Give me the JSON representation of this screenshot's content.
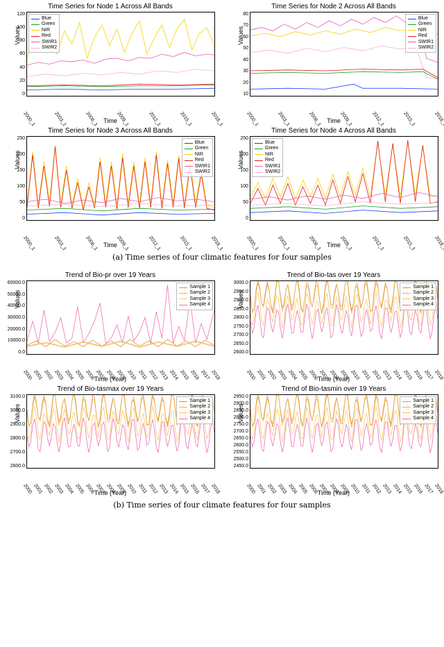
{
  "caption_a": "(a) Time series of four climatic features for four samples",
  "caption_b": "(b) Time series of four climate features for four samples",
  "xlabel_a": "Time",
  "xlabel_b": "Time (Year)",
  "ylabel": "Values",
  "legend_bands": [
    "Blue",
    "Green",
    "NIR",
    "Red",
    "SWIR1",
    "SWIR2"
  ],
  "legend_samples": [
    "Sample 1",
    "Sample 2",
    "Sample 3",
    "Sample 4"
  ],
  "band_colors": {
    "Blue": "#1f3cff",
    "Green": "#1b9e1b",
    "NIR": "#f6d400",
    "Red": "#e11919",
    "SWIR1": "#e859b4",
    "SWIR2": "#f2b2d8"
  },
  "sample_colors": {
    "Sample 1": "#e98c3a",
    "Sample 2": "#e6b84f",
    "Sample 3": "#f7c66f",
    "Sample 4": "#ef6fb2"
  },
  "xticks_a": [
    "2000_1",
    "2003_1",
    "2006_1",
    "2009_1",
    "2012_1",
    "2015_1",
    "2018_1"
  ],
  "xticks_b": [
    "2000",
    "2001",
    "2002",
    "2003",
    "2004",
    "2005",
    "2006",
    "2007",
    "2008",
    "2009",
    "2010",
    "2011",
    "2012",
    "2013",
    "2014",
    "2015",
    "2016",
    "2017",
    "2018"
  ],
  "chart_data": [
    {
      "title": "Time Series for Node 1 Across All Bands",
      "type": "line",
      "xlabel": "Time",
      "ylabel": "Values",
      "x": [
        "2000_1",
        "2003_1",
        "2006_1",
        "2009_1",
        "2012_1",
        "2015_1",
        "2018_1"
      ],
      "ylim": [
        0,
        120
      ],
      "yticks": [
        0,
        20,
        40,
        60,
        80,
        100,
        120
      ],
      "series": [
        {
          "name": "Blue",
          "approx_range": [
            7,
            12
          ],
          "mean": 9
        },
        {
          "name": "Green",
          "approx_range": [
            10,
            16
          ],
          "mean": 13
        },
        {
          "name": "NIR",
          "approx_range": [
            40,
            115
          ],
          "mean": 80,
          "note": "high-amplitude oscillation"
        },
        {
          "name": "Red",
          "approx_range": [
            12,
            18
          ],
          "mean": 14
        },
        {
          "name": "SWIR1",
          "approx_range": [
            35,
            58
          ],
          "mean": 48
        },
        {
          "name": "SWIR2",
          "approx_range": [
            20,
            35
          ],
          "mean": 27
        }
      ]
    },
    {
      "title": "Time Series for Node 2 Across All Bands",
      "type": "line",
      "xlabel": "Time",
      "ylabel": "Values",
      "x": [
        "2000_1",
        "2003_1",
        "2006_1",
        "2009_1",
        "2012_1",
        "2015_1",
        "2018_1"
      ],
      "ylim": [
        10,
        80
      ],
      "yticks": [
        10,
        20,
        30,
        40,
        50,
        60,
        70,
        80
      ],
      "series": [
        {
          "name": "Blue",
          "approx_range": [
            12,
            18
          ],
          "mean": 14
        },
        {
          "name": "Green",
          "approx_range": [
            20,
            26
          ],
          "mean": 22
        },
        {
          "name": "NIR",
          "approx_range": [
            58,
            72
          ],
          "mean": 62
        },
        {
          "name": "Red",
          "approx_range": [
            22,
            28
          ],
          "mean": 24
        },
        {
          "name": "SWIR1",
          "approx_range": [
            60,
            78
          ],
          "mean": 68,
          "note": "drops sharply to ~30 near 2019"
        },
        {
          "name": "SWIR2",
          "approx_range": [
            33,
            45
          ],
          "mean": 40,
          "note": "drops sharply to ~18 near 2019"
        }
      ]
    },
    {
      "title": "Time Series for Node 3 Across All Bands",
      "type": "line",
      "xlabel": "Time",
      "ylabel": "Values",
      "x": [
        "2000_1",
        "2003_1",
        "2006_1",
        "2009_1",
        "2012_1",
        "2015_1",
        "2018_1"
      ],
      "ylim": [
        0,
        250
      ],
      "yticks": [
        0,
        50,
        100,
        150,
        200,
        250
      ],
      "series": [
        {
          "name": "Blue",
          "approx_range": [
            10,
            40
          ],
          "mean": 20
        },
        {
          "name": "Green",
          "approx_range": [
            15,
            60
          ],
          "mean": 30
        },
        {
          "name": "NIR",
          "approx_range": [
            40,
            230
          ],
          "mean": 90,
          "note": "strong annual spikes to 200–230"
        },
        {
          "name": "Red",
          "approx_range": [
            20,
            225
          ],
          "mean": 60,
          "note": "strong annual spikes"
        },
        {
          "name": "SWIR1",
          "approx_range": [
            30,
            80
          ],
          "mean": 45
        },
        {
          "name": "SWIR2",
          "approx_range": [
            20,
            55
          ],
          "mean": 35
        }
      ]
    },
    {
      "title": "Time Series for Node 4 Across All Bands",
      "type": "line",
      "xlabel": "Time",
      "ylabel": "Values",
      "x": [
        "2000_1",
        "2003_1",
        "2006_1",
        "2009_1",
        "2012_1",
        "2015_1",
        "2018_1"
      ],
      "ylim": [
        0,
        250
      ],
      "yticks": [
        0,
        50,
        100,
        150,
        200,
        250
      ],
      "series": [
        {
          "name": "Blue",
          "approx_range": [
            15,
            45
          ],
          "mean": 25
        },
        {
          "name": "Green",
          "approx_range": [
            20,
            60
          ],
          "mean": 35
        },
        {
          "name": "NIR",
          "approx_range": [
            50,
            150
          ],
          "mean": 90,
          "note": "rises; strong spikes after 2012"
        },
        {
          "name": "Red",
          "approx_range": [
            25,
            240
          ],
          "mean": 70,
          "note": "spikes to ~240 after 2012"
        },
        {
          "name": "SWIR1",
          "approx_range": [
            40,
            90
          ],
          "mean": 55
        },
        {
          "name": "SWIR2",
          "approx_range": [
            25,
            60
          ],
          "mean": 40
        }
      ]
    },
    {
      "title": "Trend of Bio-pr over 19 Years",
      "type": "line",
      "xlabel": "Time (Year)",
      "ylabel": "Values",
      "x": [
        "2000",
        "2001",
        "2002",
        "2003",
        "2004",
        "2005",
        "2006",
        "2007",
        "2008",
        "2009",
        "2010",
        "2011",
        "2012",
        "2013",
        "2014",
        "2015",
        "2016",
        "2017",
        "2018"
      ],
      "ylim": [
        0,
        60000
      ],
      "yticks": [
        "0.0",
        "10000.0",
        "20000.0",
        "30000.0",
        "40000.0",
        "50000.0",
        "60000.0"
      ],
      "series": [
        {
          "name": "Sample 1",
          "approx_range": [
            3000,
            15000
          ],
          "mean": 7000
        },
        {
          "name": "Sample 2",
          "approx_range": [
            3000,
            15000
          ],
          "mean": 7000
        },
        {
          "name": "Sample 3",
          "approx_range": [
            3000,
            15000
          ],
          "mean": 7000
        },
        {
          "name": "Sample 4",
          "approx_range": [
            4000,
            58000
          ],
          "mean": 14000,
          "note": "large spikes to 40000–58000"
        }
      ]
    },
    {
      "title": "Trend of Bio-tas over 19 Years",
      "type": "line",
      "xlabel": "Time (Year)",
      "ylabel": "Values",
      "x": [
        "2000",
        "2001",
        "2002",
        "2003",
        "2004",
        "2005",
        "2006",
        "2007",
        "2008",
        "2009",
        "2010",
        "2011",
        "2012",
        "2013",
        "2014",
        "2015",
        "2016",
        "2017",
        "2018"
      ],
      "ylim": [
        2600,
        3000
      ],
      "yticks": [
        "2600.0",
        "2650.0",
        "2700.0",
        "2750.0",
        "2800.0",
        "2850.0",
        "2900.0",
        "2950.0",
        "3000.0"
      ],
      "series": [
        {
          "name": "Sample 1",
          "approx_range": [
            2720,
            2970
          ],
          "mean": 2850,
          "note": "seasonal oscillation"
        },
        {
          "name": "Sample 2",
          "approx_range": [
            2720,
            2970
          ],
          "mean": 2850
        },
        {
          "name": "Sample 3",
          "approx_range": [
            2640,
            2900
          ],
          "mean": 2770
        },
        {
          "name": "Sample 4",
          "approx_range": [
            2600,
            2870
          ],
          "mean": 2740
        }
      ]
    },
    {
      "title": "Trend of Bio-tasmax over 19 Years",
      "type": "line",
      "xlabel": "Time (Year)",
      "ylabel": "Values",
      "x": [
        "2000",
        "2001",
        "2002",
        "2003",
        "2004",
        "2005",
        "2006",
        "2007",
        "2008",
        "2009",
        "2010",
        "2011",
        "2012",
        "2013",
        "2014",
        "2015",
        "2016",
        "2017",
        "2018"
      ],
      "ylim": [
        2600,
        3100
      ],
      "yticks": [
        "2600.0",
        "2700.0",
        "2800.0",
        "2900.0",
        "3000.0",
        "3100.0"
      ],
      "series": [
        {
          "name": "Sample 1",
          "approx_range": [
            2800,
            3080
          ],
          "mean": 2940
        },
        {
          "name": "Sample 2",
          "approx_range": [
            2800,
            3080
          ],
          "mean": 2940
        },
        {
          "name": "Sample 3",
          "approx_range": [
            2700,
            2980
          ],
          "mean": 2840
        },
        {
          "name": "Sample 4",
          "approx_range": [
            2650,
            2950
          ],
          "mean": 2800
        }
      ]
    },
    {
      "title": "Trend of Bio-tasmin over 19 Years",
      "type": "line",
      "xlabel": "Time (Year)",
      "ylabel": "Values",
      "x": [
        "2000",
        "2001",
        "2002",
        "2003",
        "2004",
        "2005",
        "2006",
        "2007",
        "2008",
        "2009",
        "2010",
        "2011",
        "2012",
        "2013",
        "2014",
        "2015",
        "2016",
        "2017",
        "2018"
      ],
      "ylim": [
        2450,
        2950
      ],
      "yticks": [
        "2450.0",
        "2500.0",
        "2550.0",
        "2600.0",
        "2650.0",
        "2700.0",
        "2750.0",
        "2800.0",
        "2850.0",
        "2900.0",
        "2950.0"
      ],
      "series": [
        {
          "name": "Sample 1",
          "approx_range": [
            2640,
            2900
          ],
          "mean": 2780
        },
        {
          "name": "Sample 2",
          "approx_range": [
            2640,
            2900
          ],
          "mean": 2780
        },
        {
          "name": "Sample 3",
          "approx_range": [
            2550,
            2820
          ],
          "mean": 2690
        },
        {
          "name": "Sample 4",
          "approx_range": [
            2480,
            2790
          ],
          "mean": 2640
        }
      ]
    }
  ]
}
